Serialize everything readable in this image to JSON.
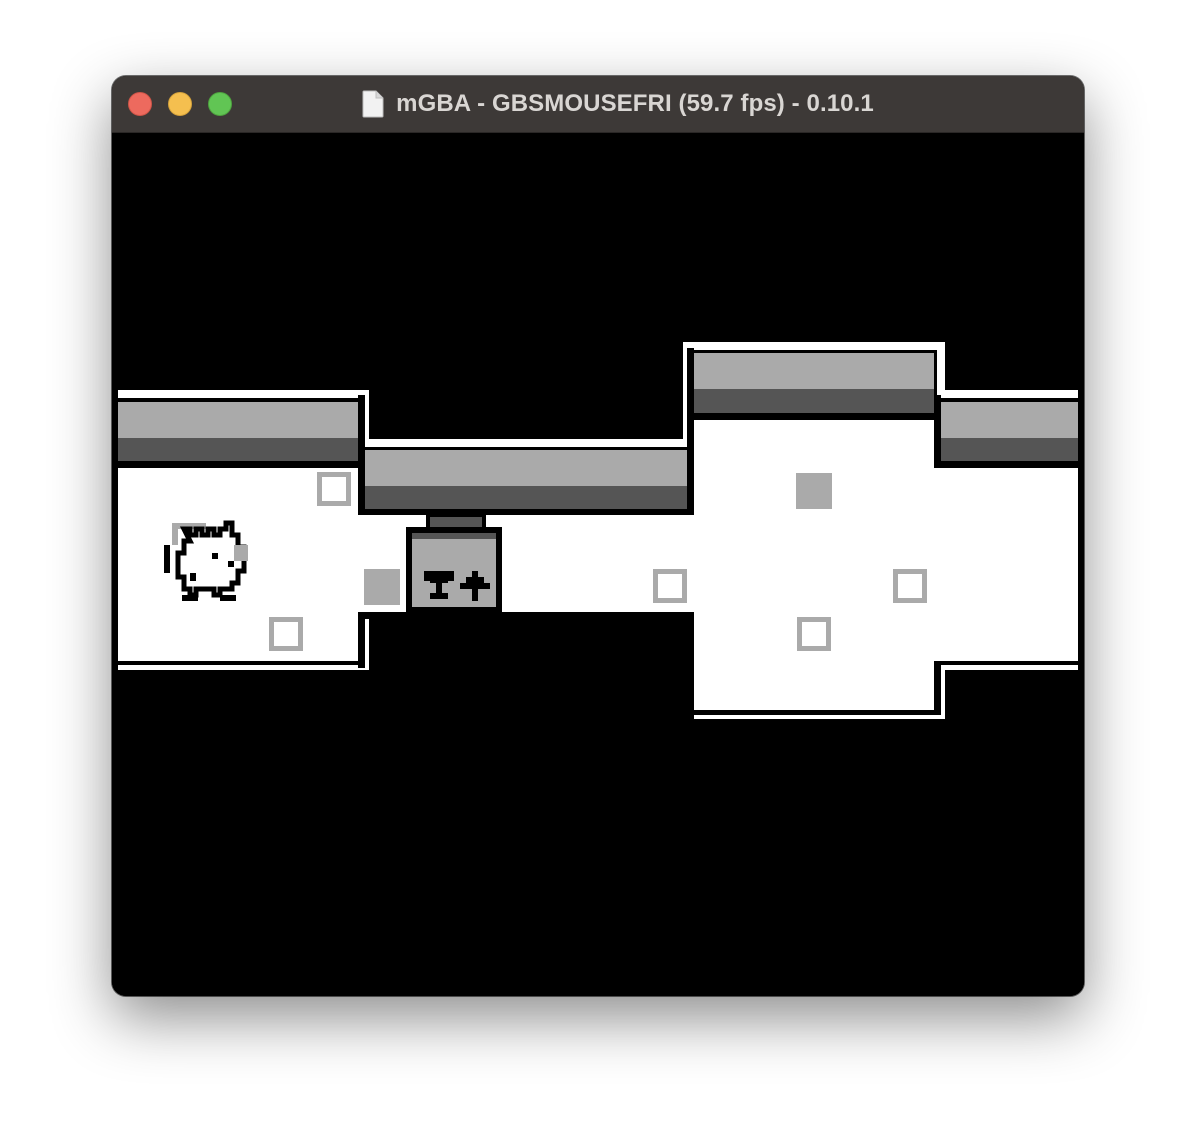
{
  "window": {
    "title": "mGBA - GBSMOUSEFRI (59.7 fps) - 0.10.1",
    "controls": [
      "close",
      "minimize",
      "zoom"
    ]
  },
  "colors": {
    "traffic_close": "#ed6a5e",
    "traffic_minimize": "#f5bf4f",
    "traffic_zoom": "#61c554",
    "gb_white": "#ffffff",
    "gb_light_gray": "#aaaaaa",
    "gb_dark_gray": "#555555",
    "gb_black": "#000000"
  },
  "game": {
    "palette": "grayscale",
    "player": "cat-sprite",
    "block": "push-block-with-up-arrow",
    "floor_markers": {
      "hollow_count": 6,
      "filled_count": 2
    }
  }
}
